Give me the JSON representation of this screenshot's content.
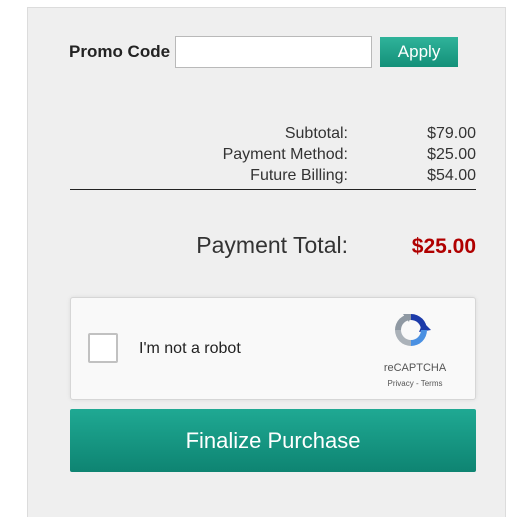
{
  "promo": {
    "label": "Promo Code",
    "input_value": "",
    "input_placeholder": "",
    "apply_label": "Apply"
  },
  "summary": {
    "rows": [
      {
        "label": "Subtotal:",
        "value": "$79.00"
      },
      {
        "label": "Payment Method:",
        "value": "$25.00"
      },
      {
        "label": "Future Billing:",
        "value": "$54.00"
      }
    ]
  },
  "total": {
    "label": "Payment Total:",
    "value": "$25.00"
  },
  "captcha": {
    "checkbox_label": "I'm not a robot",
    "brand": "reCAPTCHA",
    "privacy_label": "Privacy",
    "separator": " - ",
    "terms_label": "Terms"
  },
  "checkout": {
    "finalize_label": "Finalize Purchase"
  },
  "colors": {
    "accent": "#149079",
    "total_value": "#b00000"
  }
}
